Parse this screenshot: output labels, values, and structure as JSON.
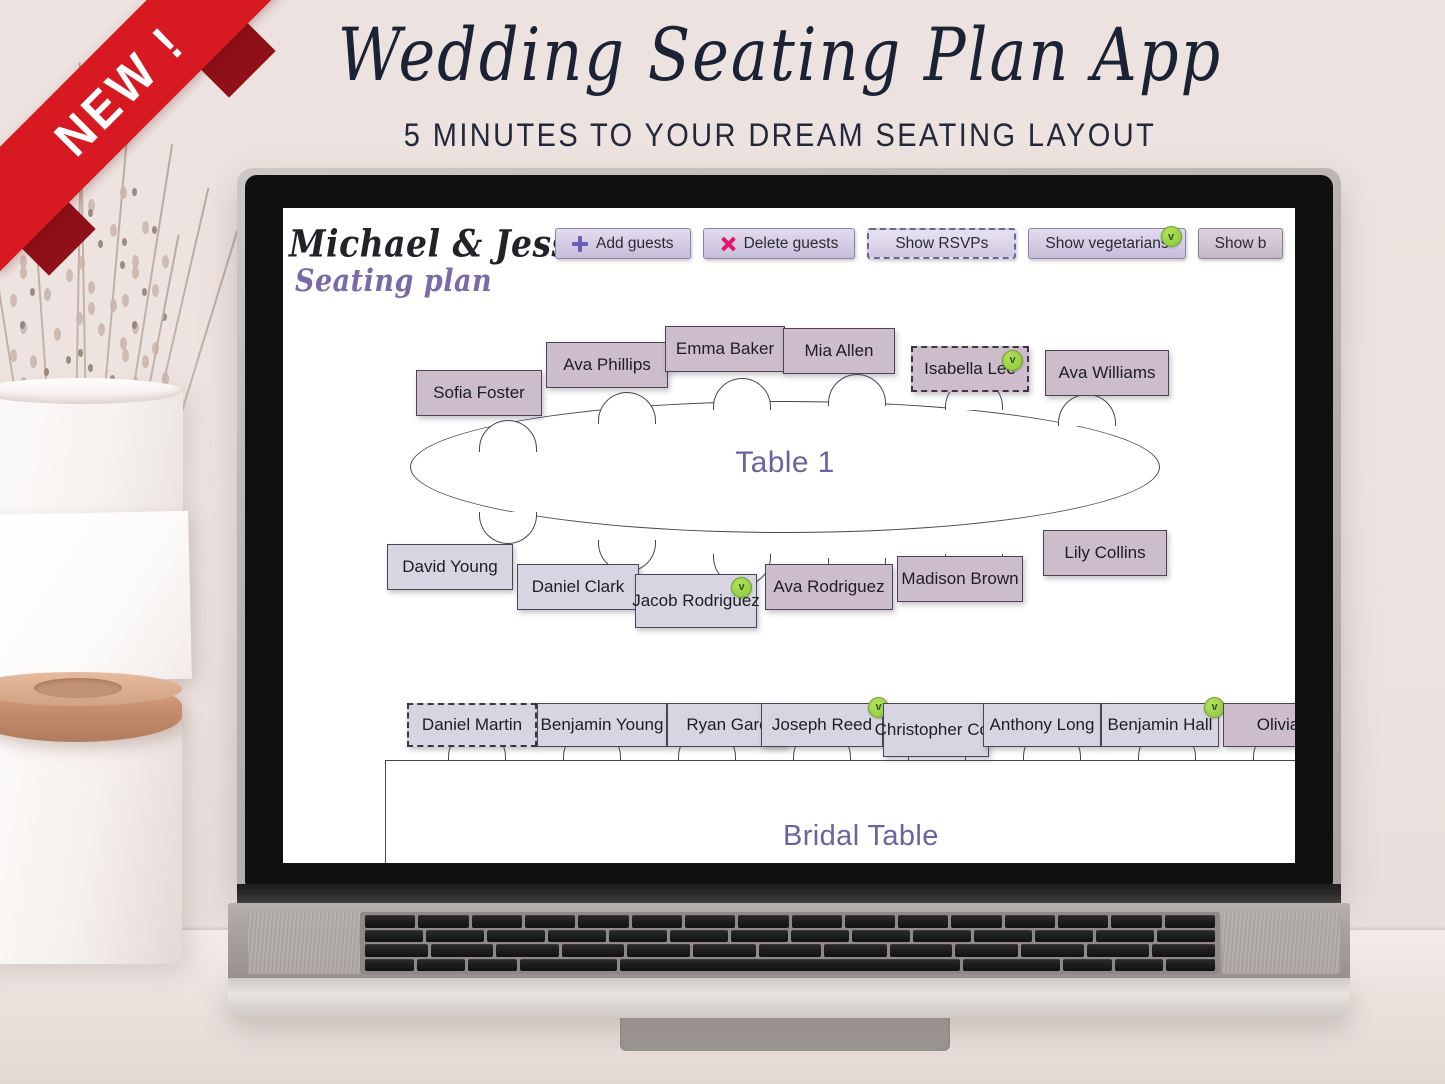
{
  "banner": {
    "title": "Wedding Seating Plan App",
    "subtitle": "5 MINUTES TO YOUR DREAM SEATING LAYOUT",
    "ribbon": "NEW !",
    "ribbon_color": "#d71921"
  },
  "app": {
    "couple_names": "Michael & Jess",
    "subtitle": "Seating plan",
    "accent_purple": "#6d62a0",
    "toolbar": [
      {
        "label": "Add guests",
        "icon": "plus-icon",
        "style": "solid",
        "veg": false
      },
      {
        "label": "Delete guests",
        "icon": "x-icon",
        "style": "solid",
        "veg": false
      },
      {
        "label": "Show RSVPs",
        "icon": "none",
        "style": "dashed",
        "veg": false
      },
      {
        "label": "Show vegetarians",
        "icon": "none",
        "style": "solid",
        "veg": true
      },
      {
        "label": "Show b",
        "icon": "none",
        "style": "mauve",
        "veg": false
      }
    ],
    "veg_badge_letter": "v",
    "tables": [
      {
        "name": "Table 1",
        "shape": "oval",
        "guests_top": [
          {
            "name": "Sofia Foster",
            "gender": "f",
            "rsvp": "confirmed",
            "vegetarian": false
          },
          {
            "name": "Ava Phillips",
            "gender": "f",
            "rsvp": "confirmed",
            "vegetarian": false
          },
          {
            "name": "Emma Baker",
            "gender": "f",
            "rsvp": "confirmed",
            "vegetarian": false
          },
          {
            "name": "Mia Allen",
            "gender": "f",
            "rsvp": "confirmed",
            "vegetarian": false
          },
          {
            "name": "Isabella Lee",
            "gender": "f",
            "rsvp": "pending",
            "vegetarian": true
          },
          {
            "name": "Ava Williams",
            "gender": "f",
            "rsvp": "confirmed",
            "vegetarian": false
          }
        ],
        "guests_bottom": [
          {
            "name": "David Young",
            "gender": "m",
            "rsvp": "confirmed",
            "vegetarian": false
          },
          {
            "name": "Daniel Clark",
            "gender": "m",
            "rsvp": "confirmed",
            "vegetarian": false
          },
          {
            "name": "Jacob Rodriguez",
            "gender": "m",
            "rsvp": "confirmed",
            "vegetarian": true
          },
          {
            "name": "Ava Rodriguez",
            "gender": "f",
            "rsvp": "confirmed",
            "vegetarian": false
          },
          {
            "name": "Madison Brown",
            "gender": "f",
            "rsvp": "confirmed",
            "vegetarian": false
          },
          {
            "name": "Lily Collins",
            "gender": "f",
            "rsvp": "confirmed",
            "vegetarian": false
          }
        ]
      },
      {
        "name": "Bridal Table",
        "shape": "rectangle",
        "guests_top": [
          {
            "name": "Daniel Martin",
            "gender": "m",
            "rsvp": "pending",
            "vegetarian": false
          },
          {
            "name": "Benjamin Young",
            "gender": "m",
            "rsvp": "confirmed",
            "vegetarian": false
          },
          {
            "name": "Ryan Garc",
            "gender": "m",
            "rsvp": "confirmed",
            "vegetarian": false
          },
          {
            "name": "Joseph Reed",
            "gender": "m",
            "rsvp": "confirmed",
            "vegetarian": true
          },
          {
            "name": "Christopher Cox",
            "gender": "m",
            "rsvp": "confirmed",
            "vegetarian": false
          },
          {
            "name": "Anthony Long",
            "gender": "m",
            "rsvp": "confirmed",
            "vegetarian": false
          },
          {
            "name": "Benjamin Hall",
            "gender": "m",
            "rsvp": "confirmed",
            "vegetarian": true
          },
          {
            "name": "Olivia",
            "gender": "f",
            "rsvp": "confirmed",
            "vegetarian": false
          }
        ]
      }
    ]
  }
}
